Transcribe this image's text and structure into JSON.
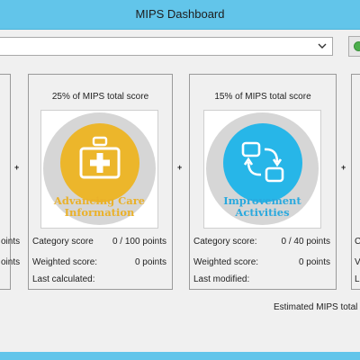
{
  "window": {
    "title": "MIPS Dashboard"
  },
  "filter": {
    "selected": ""
  },
  "operators": {
    "plus": "+"
  },
  "left_fragment": {
    "row1": "oints",
    "row2": "oints"
  },
  "categories": [
    {
      "percent_label": "25% of MIPS total score",
      "name": "Advancing Care Information",
      "name_lines": [
        "Advancing Care",
        "Information"
      ],
      "color": "#ecb62b",
      "icon": "medical-cross-icon",
      "score_label": "Category score",
      "score_value": "0 / 100 points",
      "weighted_label": "Weighted score:",
      "weighted_value": "0 points",
      "date_label": "Last calculated:",
      "date_value": ""
    },
    {
      "percent_label": "15% of MIPS total score",
      "name": "Improvement Activities",
      "name_lines": [
        "Improvement",
        "Activities"
      ],
      "color": "#27b6e8",
      "icon": "cycle-arrows-icon",
      "score_label": "Category score:",
      "score_value": "0 / 40 points",
      "weighted_label": "Weighted score:",
      "weighted_value": "0 points",
      "date_label": "Last modified:",
      "date_value": ""
    }
  ],
  "right_fragment": {
    "row1": "C",
    "row2": "V",
    "row3": "L"
  },
  "footer": {
    "estimated_label": "Estimated MIPS total"
  }
}
